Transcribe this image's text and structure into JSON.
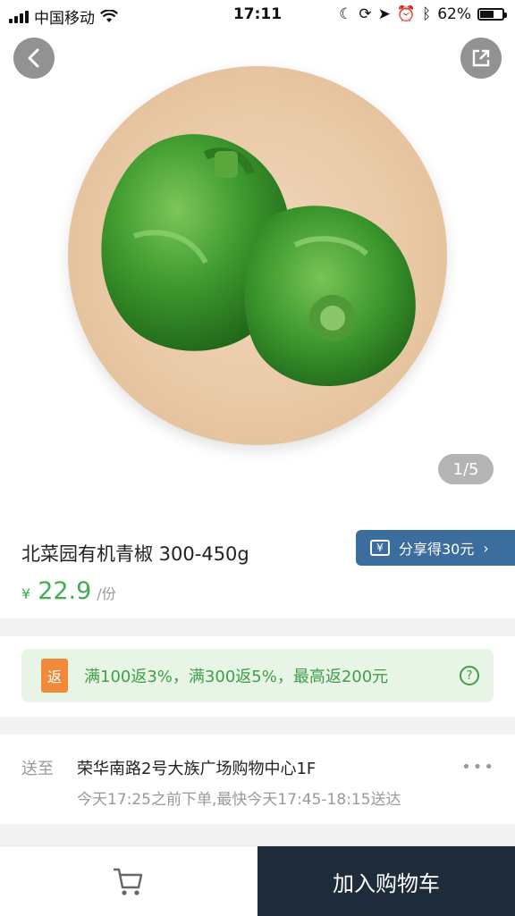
{
  "status_bar": {
    "carrier": "中国移动",
    "time": "17:11",
    "battery": "62%",
    "battery_level": 0.62
  },
  "gallery": {
    "pager": "1/5",
    "back_icon": "chevron-left-icon",
    "share_icon": "external-share-icon",
    "image": "green-peppers-on-wooden-plate"
  },
  "product": {
    "title": "北菜园有机青椒 300-450g",
    "currency": "¥",
    "price": "22.9",
    "unit": "/份",
    "share_reward": {
      "icon": "¥",
      "label": "分享得30元",
      "chevron": "›"
    }
  },
  "promotion": {
    "tag": "返",
    "text": "满100返3%，满300返5%，最高返200元",
    "help_icon": "?"
  },
  "delivery": {
    "label": "送至",
    "address": "荣华南路2号大族广场购物中心1F",
    "eta": "今天17:25之前下单,最快今天17:45-18:15送达",
    "more_icon": "•••"
  },
  "bottom_bar": {
    "cart_icon": "cart-icon",
    "add_to_cart": "加入购物车"
  },
  "colors": {
    "price_green": "#3fae4e",
    "share_blue": "#3b6e9f",
    "promo_bg": "#e8f5e6",
    "promo_tag": "#f08a3a",
    "cta_dark": "#1e2b3a"
  }
}
